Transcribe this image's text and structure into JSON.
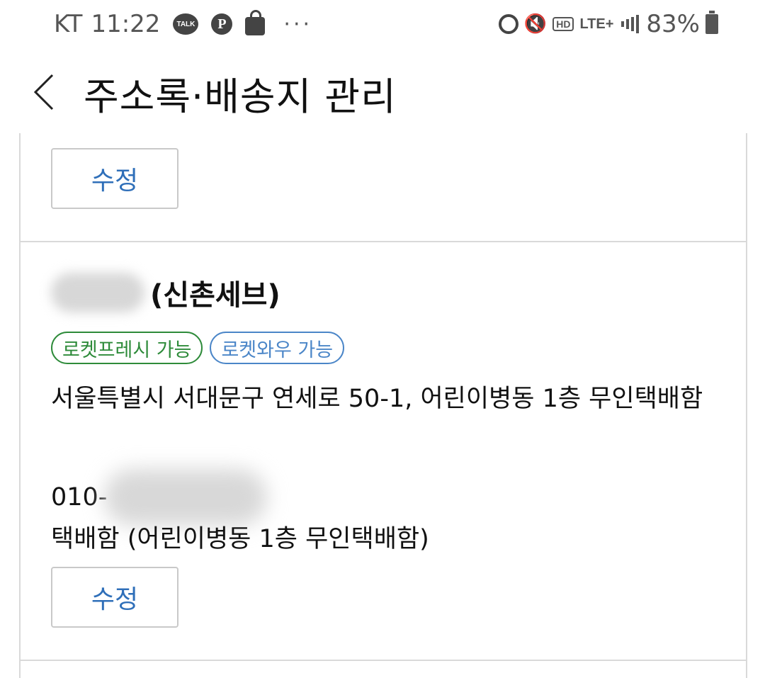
{
  "status_bar": {
    "carrier": "KT",
    "time": "11:22",
    "notif_talk_label": "TALK",
    "notif_pin_label": "P",
    "more_dots": "···",
    "hd_label": "HD",
    "network_label": "LTE+",
    "battery_percent": "83%"
  },
  "header": {
    "title": "주소록·배송지 관리"
  },
  "prev_entry": {
    "edit_label": "수정"
  },
  "entry": {
    "name_suffix": "(신촌세브)",
    "tags": [
      {
        "label": "로켓프레시 가능",
        "color": "#2e8b3a"
      },
      {
        "label": "로켓와우 가능",
        "color": "#4b86c8"
      }
    ],
    "address": "서울특별시 서대문구 연세로 50-1, 어린이병동 1층 무인택배함",
    "phone_prefix": "010-",
    "delivery_memo": "택배함 (어린이병동 1층 무인택배함)",
    "edit_label": "수정"
  },
  "colors": {
    "edit_text": "#2f6fb9",
    "divider": "#d9d9d9"
  }
}
